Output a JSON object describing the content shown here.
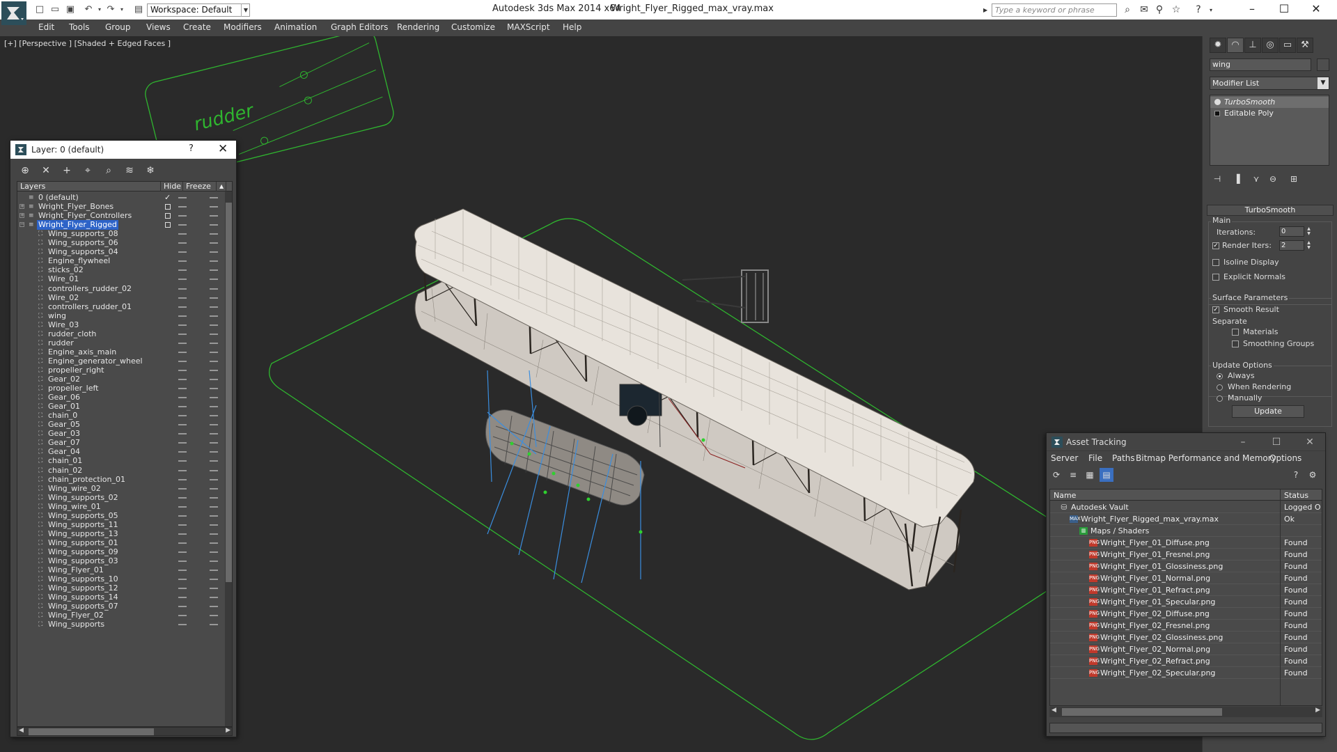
{
  "app": {
    "title": "Autodesk 3ds Max  2014 x64",
    "file": "Wright_Flyer_Rigged_max_vray.max",
    "workspace": "Workspace: Default",
    "search_placeholder": "Type a keyword or phrase"
  },
  "menu": [
    "Edit",
    "Tools",
    "Group",
    "Views",
    "Create",
    "Modifiers",
    "Animation",
    "Graph Editors",
    "Rendering",
    "Customize",
    "MAXScript",
    "Help"
  ],
  "viewport": {
    "label": "[+] [Perspective ] [Shaded + Edged Faces ]",
    "rudder_text": "rudder"
  },
  "command_panel": {
    "object_name": "wing",
    "modifier_list": "Modifier List",
    "stack": [
      "TurboSmooth",
      "Editable Poly"
    ],
    "rollout": "TurboSmooth",
    "main_group": "Main",
    "iterations_label": "Iterations:",
    "iterations_value": "0",
    "render_iters_label": "Render Iters:",
    "render_iters_value": "2",
    "isoline": "Isoline Display",
    "explicit_normals": "Explicit Normals",
    "surface_params": "Surface Parameters",
    "smooth_result": "Smooth Result",
    "separate": "Separate",
    "materials": "Materials",
    "smoothing_groups": "Smoothing Groups",
    "update_options": "Update Options",
    "always": "Always",
    "when_rendering": "When Rendering",
    "manually": "Manually",
    "update_button": "Update"
  },
  "layer_dialog": {
    "title": "Layer: 0 (default)",
    "help": "?",
    "columns": [
      "Layers",
      "Hide",
      "Freeze"
    ],
    "top_layers": [
      {
        "name": "0 (default)",
        "active": true
      },
      {
        "name": "Wright_Flyer_Bones",
        "active": false
      },
      {
        "name": "Wright_Flyer_Controllers",
        "active": false
      },
      {
        "name": "Wright_Flyer_Rigged",
        "active": false,
        "selected": true
      }
    ],
    "objects": [
      "Wing_supports_08",
      "Wing_supports_06",
      "Wing_supports_04",
      "Engine_flywheel",
      "sticks_02",
      "Wire_01",
      "controllers_rudder_02",
      "Wire_02",
      "controllers_rudder_01",
      "wing",
      "Wire_03",
      "rudder_cloth",
      "rudder",
      "Engine_axis_main",
      "Engine_generator_wheel",
      "propeller_right",
      "Gear_02",
      "propeller_left",
      "Gear_06",
      "Gear_01",
      "chain_0",
      "Gear_05",
      "Gear_03",
      "Gear_07",
      "Gear_04",
      "chain_01",
      "chain_02",
      "chain_protection_01",
      "Wing_wire_02",
      "Wing_supports_02",
      "Wing_wire_01",
      "Wing_supports_05",
      "Wing_supports_11",
      "Wing_supports_13",
      "Wing_supports_01",
      "Wing_supports_09",
      "Wing_supports_03",
      "Wing_Flyer_01",
      "Wing_supports_10",
      "Wing_supports_12",
      "Wing_supports_14",
      "Wing_supports_07",
      "Wing_Flyer_02",
      "Wing_supports"
    ]
  },
  "asset_tracking": {
    "title": "Asset Tracking",
    "menu": [
      "Server",
      "File",
      "Paths",
      "Bitmap Performance and Memory",
      "Options"
    ],
    "columns": [
      "Name",
      "Status"
    ],
    "rows": [
      {
        "name": "Autodesk Vault",
        "status": "Logged O",
        "level": 0,
        "icon": "vault-icon"
      },
      {
        "name": "Wright_Flyer_Rigged_max_vray.max",
        "status": "Ok",
        "level": 1,
        "icon": "max-file-icon"
      },
      {
        "name": "Maps / Shaders",
        "status": "",
        "level": 2,
        "icon": "maps-icon"
      },
      {
        "name": "Wright_Flyer_01_Diffuse.png",
        "status": "Found",
        "level": 3,
        "icon": "png-icon"
      },
      {
        "name": "Wright_Flyer_01_Fresnel.png",
        "status": "Found",
        "level": 3,
        "icon": "png-icon"
      },
      {
        "name": "Wright_Flyer_01_Glossiness.png",
        "status": "Found",
        "level": 3,
        "icon": "png-icon"
      },
      {
        "name": "Wright_Flyer_01_Normal.png",
        "status": "Found",
        "level": 3,
        "icon": "png-icon"
      },
      {
        "name": "Wright_Flyer_01_Refract.png",
        "status": "Found",
        "level": 3,
        "icon": "png-icon"
      },
      {
        "name": "Wright_Flyer_01_Specular.png",
        "status": "Found",
        "level": 3,
        "icon": "png-icon"
      },
      {
        "name": "Wright_Flyer_02_Diffuse.png",
        "status": "Found",
        "level": 3,
        "icon": "png-icon"
      },
      {
        "name": "Wright_Flyer_02_Fresnel.png",
        "status": "Found",
        "level": 3,
        "icon": "png-icon"
      },
      {
        "name": "Wright_Flyer_02_Glossiness.png",
        "status": "Found",
        "level": 3,
        "icon": "png-icon"
      },
      {
        "name": "Wright_Flyer_02_Normal.png",
        "status": "Found",
        "level": 3,
        "icon": "png-icon"
      },
      {
        "name": "Wright_Flyer_02_Refract.png",
        "status": "Found",
        "level": 3,
        "icon": "png-icon"
      },
      {
        "name": "Wright_Flyer_02_Specular.png",
        "status": "Found",
        "level": 3,
        "icon": "png-icon"
      }
    ]
  },
  "colors": {
    "selection_blue": "#2d63c8",
    "viewport_bg": "#2a2a2a",
    "ui_gray": "#444444",
    "green_wire": "#2fb52f"
  }
}
